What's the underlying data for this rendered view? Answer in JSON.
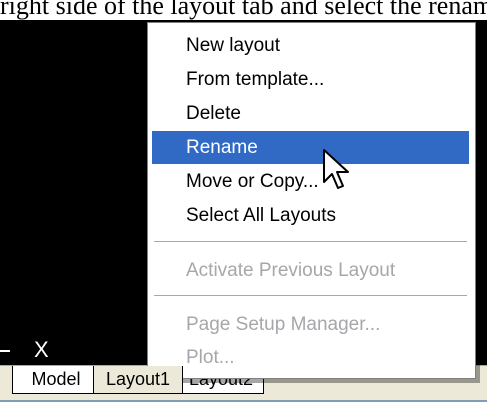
{
  "caption": "right side of the layout tab and select the rename",
  "canvas": {
    "ucs_axis_label": "X"
  },
  "context_menu": {
    "items": [
      {
        "label": "New layout",
        "enabled": true,
        "selected": false
      },
      {
        "label": "From template...",
        "enabled": true,
        "selected": false
      },
      {
        "label": "Delete",
        "enabled": true,
        "selected": false
      },
      {
        "label": "Rename",
        "enabled": true,
        "selected": true
      },
      {
        "label": "Move or Copy...",
        "enabled": true,
        "selected": false
      },
      {
        "label": "Select All Layouts",
        "enabled": true,
        "selected": false
      },
      {
        "label": "Activate Previous Layout",
        "enabled": false,
        "selected": false
      },
      {
        "label": "Page Setup Manager...",
        "enabled": false,
        "selected": false
      },
      {
        "label": "Plot...",
        "enabled": false,
        "selected": false
      }
    ]
  },
  "tabs": [
    {
      "label": "Model",
      "active": false
    },
    {
      "label": "Layout1",
      "active": true
    },
    {
      "label": "Layout2",
      "active": false
    }
  ],
  "colors": {
    "canvas_bg": "#000000",
    "highlight": "#316ac5",
    "disabled_text": "#a7a6aa"
  },
  "cursor_icon": "arrow-pointer-icon"
}
